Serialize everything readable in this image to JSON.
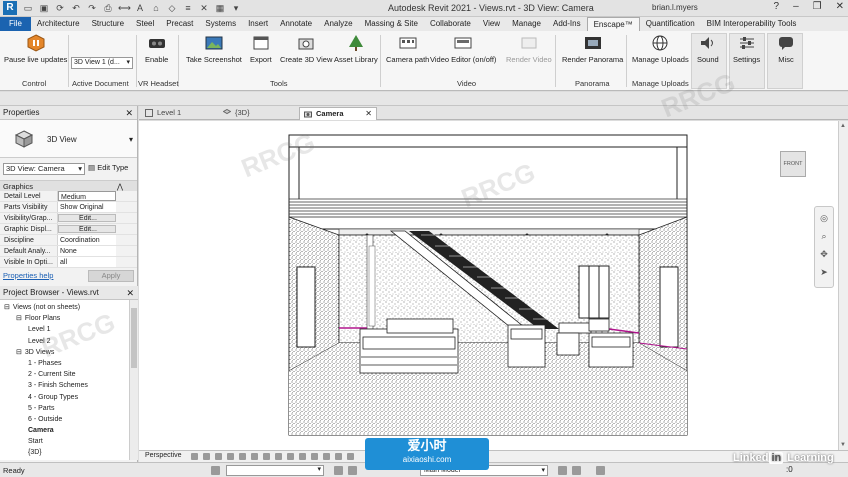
{
  "window": {
    "title": "Autodesk Revit 2021 - Views.rvt - 3D View: Camera",
    "user": "brian.l.myers",
    "logo_letter": "R"
  },
  "ribbon_tabs": [
    "File",
    "Architecture",
    "Structure",
    "Steel",
    "Precast",
    "Systems",
    "Insert",
    "Annotate",
    "Analyze",
    "Massing & Site",
    "Collaborate",
    "View",
    "Manage",
    "Add-Ins",
    "Enscape™",
    "Quantification",
    "BIM Interoperability Tools"
  ],
  "active_tab": "Enscape™",
  "ribbon": {
    "pause_live_updates": "Pause live updates",
    "view_combo": "3D View 1 (d...",
    "enable": "Enable",
    "take_screenshot": "Take Screenshot",
    "export": "Export",
    "create_3d_view": "Create 3D View",
    "asset_library": "Asset Library",
    "camera_path": "Camera path",
    "video_editor": "Video Editor (on/off)",
    "render_video": "Render Video",
    "render_panorama": "Render Panorama",
    "manage_uploads": "Manage Uploads",
    "sound": "Sound",
    "settings": "Settings",
    "misc": "Misc",
    "panels": {
      "control": "Control",
      "active_document": "Active Document",
      "vr_headset": "VR Headset",
      "tools": "Tools",
      "video": "Video",
      "panorama": "Panorama",
      "manage_uploads": "Manage Uploads"
    }
  },
  "properties": {
    "title": "Properties",
    "type_name": "3D View",
    "selector": "3D View: Camera",
    "edit_type": "Edit Type",
    "group": "Graphics",
    "rows": [
      {
        "key": "Detail Level",
        "value": "Medium"
      },
      {
        "key": "Parts Visibility",
        "value": "Show Original"
      },
      {
        "key": "Visibility/Grap...",
        "value": "Edit..."
      },
      {
        "key": "Graphic Displ...",
        "value": "Edit..."
      },
      {
        "key": "Discipline",
        "value": "Coordination"
      },
      {
        "key": "Default Analy...",
        "value": "None"
      },
      {
        "key": "Visible In Opti...",
        "value": "all"
      }
    ],
    "help": "Properties help",
    "apply": "Apply"
  },
  "project_browser": {
    "title": "Project Browser - Views.rvt",
    "items": [
      {
        "label": "Views (not on sheets)",
        "level": 0,
        "toggle": "⊟"
      },
      {
        "label": "Floor Plans",
        "level": 1,
        "toggle": "⊟"
      },
      {
        "label": "Level 1",
        "level": 2,
        "toggle": ""
      },
      {
        "label": "Level 2",
        "level": 2,
        "toggle": ""
      },
      {
        "label": "3D Views",
        "level": 1,
        "toggle": "⊟"
      },
      {
        "label": "1 - Phases",
        "level": 2,
        "toggle": ""
      },
      {
        "label": "2 - Current Site",
        "level": 2,
        "toggle": ""
      },
      {
        "label": "3 - Finish Schemes",
        "level": 2,
        "toggle": ""
      },
      {
        "label": "4 - Group Types",
        "level": 2,
        "toggle": ""
      },
      {
        "label": "5 - Parts",
        "level": 2,
        "toggle": ""
      },
      {
        "label": "6 - Outside",
        "level": 2,
        "toggle": ""
      },
      {
        "label": "Camera",
        "level": 2,
        "toggle": "",
        "bold": true
      },
      {
        "label": "Start",
        "level": 2,
        "toggle": ""
      },
      {
        "label": "{3D}",
        "level": 2,
        "toggle": ""
      }
    ]
  },
  "view_tabs": [
    {
      "label": "Level 1",
      "active": false
    },
    {
      "label": "{3D}",
      "active": false
    },
    {
      "label": "Camera",
      "active": true
    }
  ],
  "viewcube_label": "FRONT",
  "view_control": {
    "style": "Perspective"
  },
  "status": {
    "ready": "Ready",
    "model": "Main Model",
    "filter": ":0"
  },
  "watermark": {
    "brand": "Linked",
    "brand_in": "in",
    "brand_tail": " Learning",
    "badge_title": "爱小时",
    "badge_url": "aixiaoshi.com"
  },
  "colors": {
    "file_tab": "#1b63b0",
    "link": "#1a5fb4",
    "accent_magenta": "#b0138c"
  }
}
